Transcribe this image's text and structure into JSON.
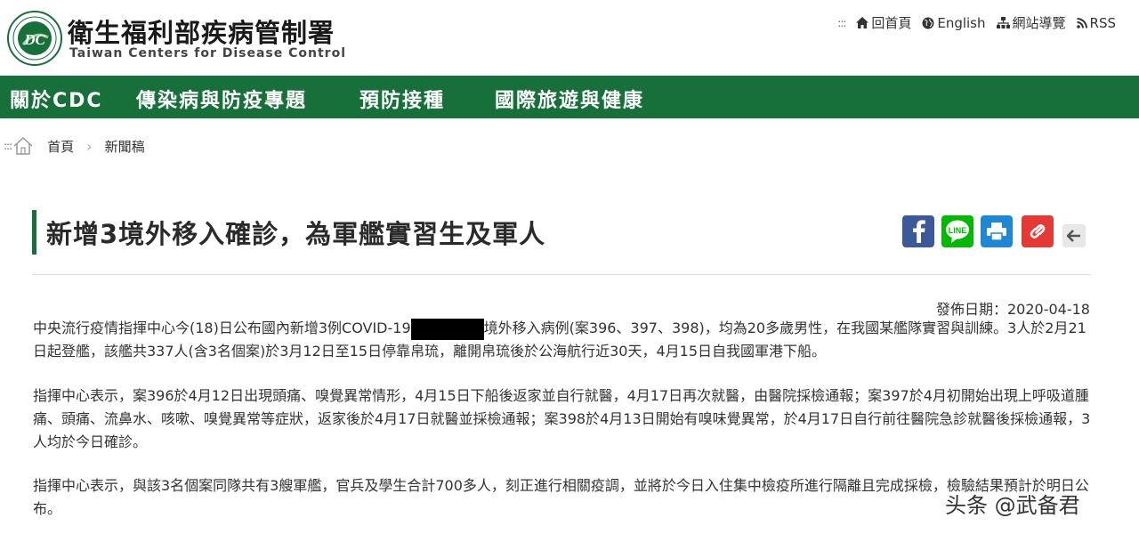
{
  "header": {
    "org_name_cn": "衛生福利部疾病管制署",
    "org_name_en": "Taiwan Centers for Disease Control",
    "menu_dots": ":::",
    "top_links": [
      {
        "label": "回首頁",
        "icon": "home-icon"
      },
      {
        "label": "English",
        "icon": "globe-icon"
      },
      {
        "label": "網站導覽",
        "icon": "sitemap-icon"
      },
      {
        "label": "RSS",
        "icon": "rss-icon"
      }
    ]
  },
  "nav": {
    "items": [
      {
        "label": "關於CDC"
      },
      {
        "label": "傳染病與防疫專題"
      },
      {
        "label": "預防接種"
      },
      {
        "label": "國際旅遊與健康"
      }
    ]
  },
  "breadcrumb": {
    "dots": ":::",
    "items": [
      {
        "label": "首頁"
      },
      {
        "label": "新聞稿"
      }
    ],
    "separator": "›"
  },
  "article": {
    "title": "新增3境外移入確診，為軍艦實習生及軍人",
    "date": "發佈日期：2020-04-18",
    "p1_before": "中央流行疫情指揮中心今(18)日公布國內新增3例COVID-19",
    "p1_after": "境外移入病例(案396、397、398)，均為20多歲男性，在我國某艦隊實習與訓練。3人於2月21日起登艦，該艦共337人(含3名個案)於3月12日至15日停靠帛琉，離開帛琉後於公海航行近30天，4月15日自我國軍港下船。",
    "p2": "指揮中心表示，案396於4月12日出現頭痛、嗅覺異常情形，4月15日下船後返家並自行就醫，4月17日再次就醫，由醫院採檢通報；案397於4月初開始出現上呼吸道腫痛、頭痛、流鼻水、咳嗽、嗅覺異常等症狀，返家後於4月17日就醫並採檢通報；案398於4月13日開始有嗅味覺異常，於4月17日自行前往醫院急診就醫後採檢通報，3人均於今日確診。",
    "p3": "指揮中心表示，與該3名個案同隊共有3艘軍艦，官兵及學生合計700多人，刻正進行相關疫調，並將於今日入住集中檢疫所進行隔離且完成採檢，檢驗結果預計於明日公布。"
  },
  "share_buttons": [
    {
      "icon": "facebook-icon",
      "color": "#3b5998"
    },
    {
      "icon": "line-icon",
      "color": "#00b900"
    },
    {
      "icon": "print-icon",
      "color": "#1e88d6"
    },
    {
      "icon": "link-icon",
      "color": "#e53935"
    }
  ],
  "colors": {
    "brand_green": "#17703a"
  },
  "watermark": "头条 @武备君"
}
